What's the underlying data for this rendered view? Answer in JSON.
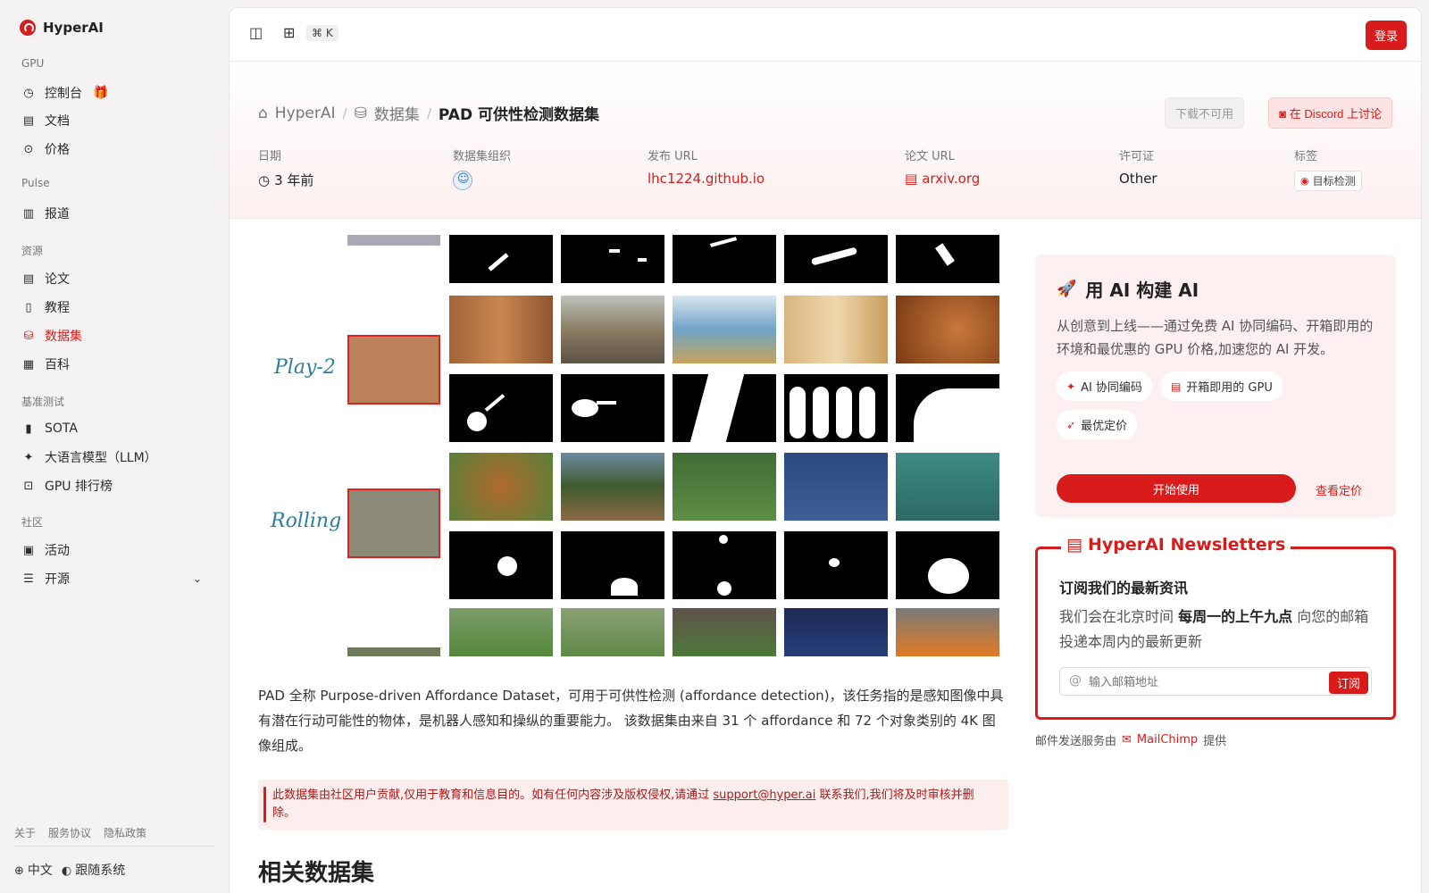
{
  "brand": {
    "name": "HyperAI"
  },
  "sidebar": {
    "sections": [
      {
        "label": "GPU",
        "items": [
          {
            "label": "控制台",
            "icon": "dashboard-icon"
          },
          {
            "label": "文档",
            "icon": "doc-icon"
          },
          {
            "label": "价格",
            "icon": "price-icon"
          }
        ]
      },
      {
        "label": "Pulse",
        "items": [
          {
            "label": "报道",
            "icon": "news-icon"
          }
        ]
      },
      {
        "label": "资源",
        "items": [
          {
            "label": "论文"
          },
          {
            "label": "教程"
          },
          {
            "label": "数据集",
            "active": true
          },
          {
            "label": "百科"
          }
        ]
      },
      {
        "label": "基准测试",
        "items": [
          {
            "label": "SOTA"
          },
          {
            "label": "大语言模型（LLM）"
          },
          {
            "label": "GPU 排行榜"
          }
        ]
      },
      {
        "label": "社区",
        "items": [
          {
            "label": "活动"
          },
          {
            "label": "开源"
          }
        ]
      }
    ],
    "footer_links": [
      "关于",
      "服务协议",
      "隐私政策"
    ],
    "language": "中文",
    "theme": "跟随系统"
  },
  "topbar": {
    "shortcut": "⌘ K",
    "login": "登录"
  },
  "breadcrumb": {
    "home": "HyperAI",
    "section": "数据集",
    "current": "PAD 可供性检测数据集"
  },
  "actions": {
    "download": "下载不可用",
    "discord": "在 Discord 上讨论"
  },
  "meta": {
    "date_label": "日期",
    "date_value": "3 年前",
    "org_label": "数据集组织",
    "url_label": "发布 URL",
    "url_value": "lhc1224.github.io",
    "paper_label": "论文 URL",
    "paper_value": "arxiv.org",
    "license_label": "许可证",
    "license_value": "Other",
    "tags_label": "标签",
    "tag_value": "目标检测"
  },
  "figure": {
    "row_labels": [
      "Play-2",
      "Rolling"
    ]
  },
  "description": "PAD 全称 Purpose-driven Affordance Dataset，可用于可供性检测 (affordance detection)，该任务指的是感知图像中具有潜在行动可能性的物体，是机器人感知和操纵的重要能力。 该数据集由来自 31 个 affordance 和 72 个对象类别的 4K 图像组成。",
  "notice": {
    "text_before": "此数据集由社区用户贡献,仅用于教育和信息目的。如有任何内容涉及版权侵权,请通过 ",
    "email": "support@hyper.ai",
    "text_after": " 联系我们,我们将及时审核并删除。"
  },
  "related_title": "相关数据集",
  "ai_card": {
    "title": "用 AI 构建 AI",
    "desc": "从创意到上线——通过免费 AI 协同编码、开箱即用的环境和最优惠的 GPU 价格,加速您的 AI 开发。",
    "chips": [
      "AI 协同编码",
      "开箱即用的 GPU",
      "最优定价"
    ],
    "start": "开始使用",
    "pricing": "查看定价"
  },
  "newsletter": {
    "title": "HyperAI Newsletters",
    "subtitle": "订阅我们的最新资讯",
    "desc_before": "我们会在北京时间 ",
    "desc_bold": "每周一的上午九点",
    "desc_after": " 向您的邮箱投递本周内的最新更新",
    "placeholder": "输入邮箱地址",
    "subscribe": "订阅",
    "provider_before": "邮件发送服务由",
    "provider_name": "MailChimp",
    "provider_after": "提供"
  },
  "colors": {
    "accent": "#d81b1b",
    "sidebar_bg": "#f4f2f2",
    "hero_tint": "#fdf0f0"
  }
}
